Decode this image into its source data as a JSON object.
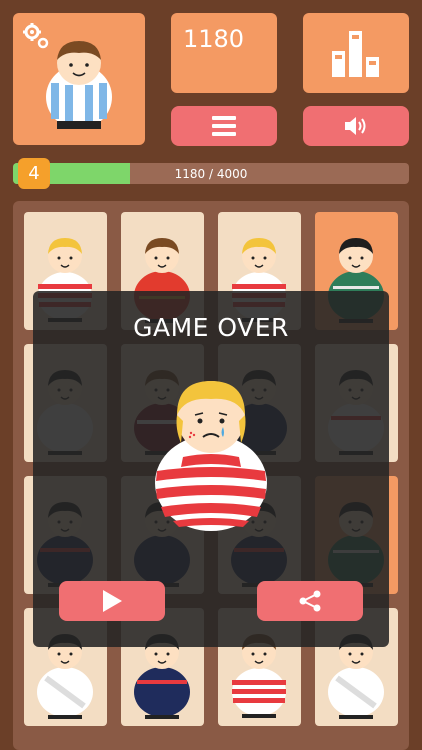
{
  "score": "1180",
  "level": "4",
  "progress": {
    "current": 1180,
    "target": 4000,
    "label": "1180 / 4000",
    "fraction": 0.295
  },
  "modal": {
    "title": "GAME OVER"
  },
  "icons": {
    "settings": "gear-icon",
    "leaderboard": "bar-chart-icon",
    "menu": "hamburger-menu-icon",
    "sound": "speaker-icon",
    "play": "play-icon",
    "share": "share-icon"
  },
  "colors": {
    "background": "#6b3f28",
    "card": "#f49a63",
    "button": "#f06f72",
    "progress_fill": "#7ed66a",
    "level_badge": "#f5a02b",
    "tile": "#f3ddc3"
  },
  "board": {
    "rows": [
      [
        "blonde-red-stripes",
        "brown-red-spain",
        "blonde-red-stripes",
        "black-green-shirt"
      ],
      [
        "black-white-shirt",
        "brown-maroon-shirt",
        "black-navy-shirt",
        "black-white-red-band"
      ],
      [
        "black-navy-red-band",
        "black-navy-shirt",
        "black-navy-red-band",
        "black-green-shirt"
      ],
      [
        "black-white-sash",
        "black-navy-red-band",
        "brown-red-stripes",
        "black-white-sash"
      ]
    ],
    "highlighted_tiles": [
      "0-3",
      "2-3"
    ]
  }
}
